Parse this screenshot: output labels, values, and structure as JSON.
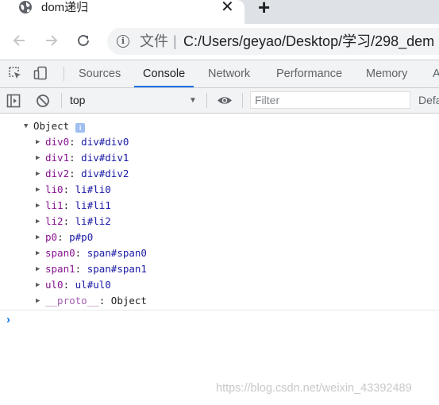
{
  "browser": {
    "tab_title": "dom递归",
    "tab_close": "✕",
    "new_tab": "+",
    "omnibox_label": "文件",
    "omnibox_separator": "|",
    "url": "C:/Users/geyao/Desktop/学习/298_dem"
  },
  "devtools": {
    "tabs": [
      "Sources",
      "Console",
      "Network",
      "Performance",
      "Memory",
      "A"
    ],
    "active_tab": "Console"
  },
  "console_toolbar": {
    "context": "top",
    "filter_placeholder": "Filter",
    "levels": "Default"
  },
  "console": {
    "object_label": "Object",
    "info_badge": "i",
    "entries": [
      {
        "key": "div0",
        "value": "div#div0"
      },
      {
        "key": "div1",
        "value": "div#div1"
      },
      {
        "key": "div2",
        "value": "div#div2"
      },
      {
        "key": "li0",
        "value": "li#li0"
      },
      {
        "key": "li1",
        "value": "li#li1"
      },
      {
        "key": "li2",
        "value": "li#li2"
      },
      {
        "key": "p0",
        "value": "p#p0"
      },
      {
        "key": "span0",
        "value": "span#span0"
      },
      {
        "key": "span1",
        "value": "span#span1"
      },
      {
        "key": "ul0",
        "value": "ul#ul0"
      }
    ],
    "proto_key": "__proto__",
    "proto_value": "Object",
    "prompt": "›"
  },
  "watermark": "https://blog.csdn.net/weixin_43392489",
  "colors": {
    "key": "#881391",
    "value": "#1a1aa6",
    "accent": "#1a73e8"
  }
}
